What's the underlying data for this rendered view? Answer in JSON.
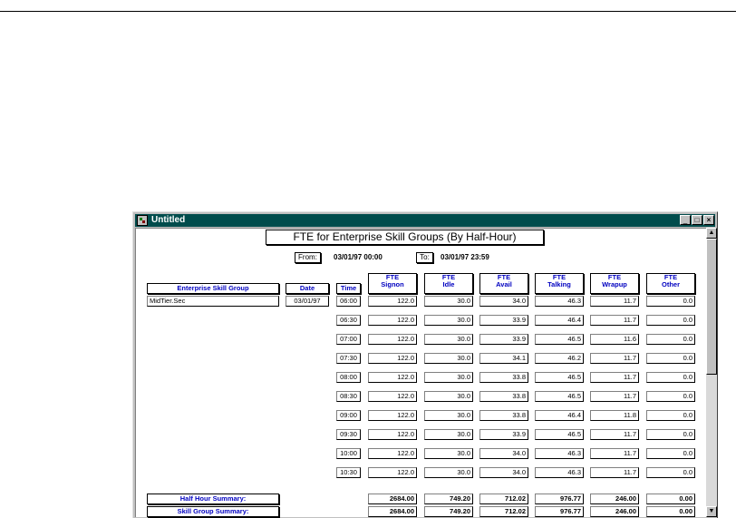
{
  "window": {
    "title": "Untitled",
    "buttons": {
      "minimize": "_",
      "maximize": "□",
      "close": "×"
    }
  },
  "report": {
    "title": "FTE for Enterprise Skill Groups (By Half-Hour)",
    "from_label": "From:",
    "from_value": "03/01/97 00:00",
    "to_label": "To:",
    "to_value": "03/01/97 23:59"
  },
  "headers": {
    "skill_group": "Enterprise Skill Group",
    "date": "Date",
    "time": "Time",
    "signon": [
      "FTE",
      "Signon"
    ],
    "idle": [
      "FTE",
      "Idle"
    ],
    "avail": [
      "FTE",
      "Avail"
    ],
    "talking": [
      "FTE",
      "Talking"
    ],
    "wrapup": [
      "FTE",
      "Wrapup"
    ],
    "other": [
      "FTE",
      "Other"
    ]
  },
  "skill_group": {
    "name": "MidTier.Sec",
    "date": "03/01/97"
  },
  "rows": [
    {
      "time": "06:00",
      "signon": "122.0",
      "idle": "30.0",
      "avail": "34.0",
      "talking": "46.3",
      "wrapup": "11.7",
      "other": "0.0"
    },
    {
      "time": "06:30",
      "signon": "122.0",
      "idle": "30.0",
      "avail": "33.9",
      "talking": "46.4",
      "wrapup": "11.7",
      "other": "0.0"
    },
    {
      "time": "07:00",
      "signon": "122.0",
      "idle": "30.0",
      "avail": "33.9",
      "talking": "46.5",
      "wrapup": "11.6",
      "other": "0.0"
    },
    {
      "time": "07:30",
      "signon": "122.0",
      "idle": "30.0",
      "avail": "34.1",
      "talking": "46.2",
      "wrapup": "11.7",
      "other": "0.0"
    },
    {
      "time": "08:00",
      "signon": "122.0",
      "idle": "30.0",
      "avail": "33.8",
      "talking": "46.5",
      "wrapup": "11.7",
      "other": "0.0"
    },
    {
      "time": "08:30",
      "signon": "122.0",
      "idle": "30.0",
      "avail": "33.8",
      "talking": "46.5",
      "wrapup": "11.7",
      "other": "0.0"
    },
    {
      "time": "09:00",
      "signon": "122.0",
      "idle": "30.0",
      "avail": "33.8",
      "talking": "46.4",
      "wrapup": "11.8",
      "other": "0.0"
    },
    {
      "time": "09:30",
      "signon": "122.0",
      "idle": "30.0",
      "avail": "33.9",
      "talking": "46.5",
      "wrapup": "11.7",
      "other": "0.0"
    },
    {
      "time": "10:00",
      "signon": "122.0",
      "idle": "30.0",
      "avail": "34.0",
      "talking": "46.3",
      "wrapup": "11.7",
      "other": "0.0"
    },
    {
      "time": "10:30",
      "signon": "122.0",
      "idle": "30.0",
      "avail": "34.0",
      "talking": "46.3",
      "wrapup": "11.7",
      "other": "0.0"
    }
  ],
  "summaries": [
    {
      "label": "Half Hour Summary:",
      "signon": "2684.00",
      "idle": "749.20",
      "avail": "712.02",
      "talking": "976.77",
      "wrapup": "246.00",
      "other": "0.00"
    },
    {
      "label": "Skill Group Summary:",
      "signon": "2684.00",
      "idle": "749.20",
      "avail": "712.02",
      "talking": "976.77",
      "wrapup": "246.00",
      "other": "0.00"
    }
  ]
}
